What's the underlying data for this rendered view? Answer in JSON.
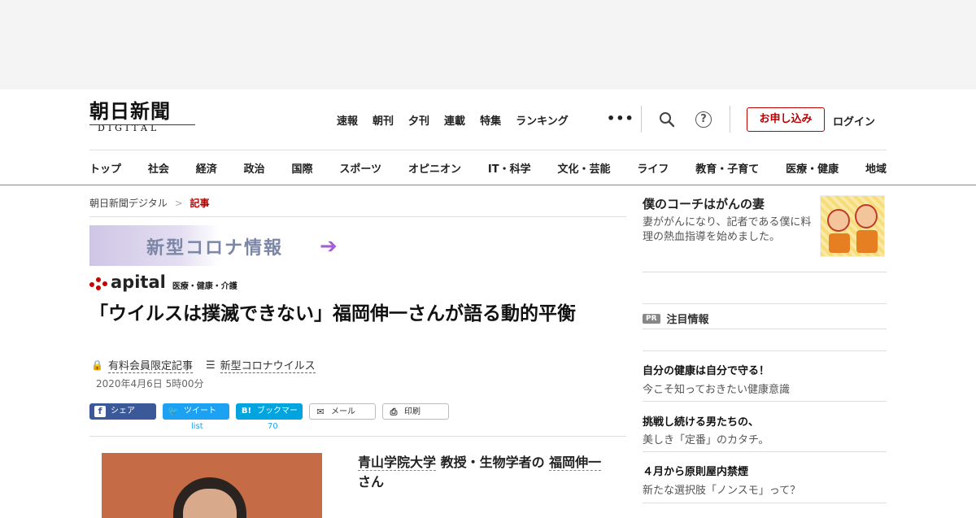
{
  "header": {
    "logo_main": "朝日新聞",
    "logo_sub": "DIGITAL",
    "top_nav": [
      "速報",
      "朝刊",
      "夕刊",
      "連載",
      "特集",
      "ランキング"
    ],
    "more_label": "•••",
    "help_label": "?",
    "signup_label": "お申し込み",
    "login_label": "ログイン",
    "categories": [
      "トップ",
      "社会",
      "経済",
      "政治",
      "国際",
      "スポーツ",
      "オピニオン",
      "IT・科学",
      "文化・芸能",
      "ライフ",
      "教育・子育て",
      "医療・健康",
      "地域"
    ]
  },
  "breadcrumb": {
    "home": "朝日新聞デジタル",
    "separator": ">",
    "current": "記事"
  },
  "banner": {
    "text": "新型コロナ情報",
    "arrow": "➔"
  },
  "apital": {
    "logo": "apital",
    "tag": "医療・健康・介護"
  },
  "article": {
    "title": "「ウイルスは撲滅できない」福岡伸一さんが語る動的平衡",
    "members_only": "有料会員限定記事",
    "topic": "新型コロナウイルス",
    "date": "2020年4月6日 5時00分",
    "share": {
      "facebook": "シェア",
      "twitter": "ツイート",
      "hatena": "ブックマーク",
      "mail": "メール",
      "print": "印刷",
      "twitter_count": "list",
      "hatena_count": "70"
    },
    "caption": {
      "affiliation": "青山学院大学",
      "role": " 教授・生物学者の ",
      "name": "福岡伸一",
      "suffix": " さん"
    }
  },
  "sidebar": {
    "feature_title": "僕のコーチはがんの妻",
    "feature_desc": "妻ががんになり、記者である僕に料理の熱血指導を始めました。",
    "pr_badge": "PR",
    "pr_label": "注目情報",
    "ads": [
      {
        "title": "自分の健康は自分で守る！",
        "sub": "今こそ知っておきたい健康意識"
      },
      {
        "title": "挑戦し続ける男たちの、",
        "sub": "美しき「定番」のカタチ。"
      },
      {
        "title": "４月から原則屋内禁煙",
        "sub": "新たな選択肢「ノンスモ」って？"
      }
    ]
  },
  "colors": {
    "brand_red": "#b00000",
    "facebook": "#3b5998",
    "twitter": "#1da1f2",
    "hatena": "#00a4de"
  }
}
